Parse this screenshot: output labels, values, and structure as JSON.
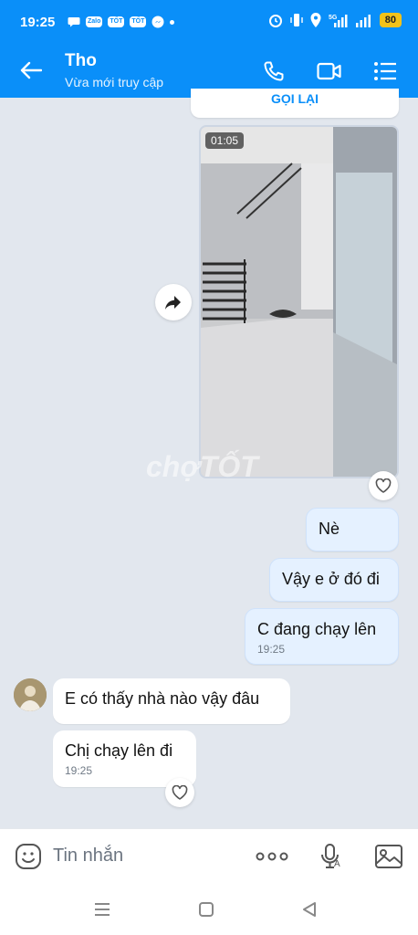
{
  "status_bar": {
    "time": "19:25",
    "battery": "80",
    "network": "5G",
    "app_badges": [
      "Zalo",
      "TỐT",
      "TỐT"
    ]
  },
  "header": {
    "contact_name": "Tho",
    "presence": "Vừa mới truy cập"
  },
  "call_bubble": {
    "label": "GỌI LẠI"
  },
  "video": {
    "duration": "01:05"
  },
  "watermark": "chợTỐT",
  "messages": [
    {
      "text": "Nè"
    },
    {
      "text": "Vậy e ở đó đi"
    },
    {
      "text": "C đang chạy lên",
      "time": "19:25"
    },
    {
      "text": "E có thấy nhà nào vậy đâu"
    },
    {
      "text": "Chị chạy lên đi",
      "time": "19:25"
    }
  ],
  "composer": {
    "placeholder": "Tin nhắn"
  },
  "colors": {
    "accent": "#0a8ff9",
    "sent_bubble": "#e5f1ff",
    "chat_bg": "#e2e7ee"
  },
  "icons": [
    "back-arrow-icon",
    "phone-icon",
    "video-camera-icon",
    "menu-list-icon",
    "share-forward-icon",
    "heart-icon",
    "sticker-icon",
    "more-dots-icon",
    "microphone-icon",
    "image-icon",
    "nav-menu-icon",
    "nav-home-icon",
    "nav-back-icon"
  ]
}
